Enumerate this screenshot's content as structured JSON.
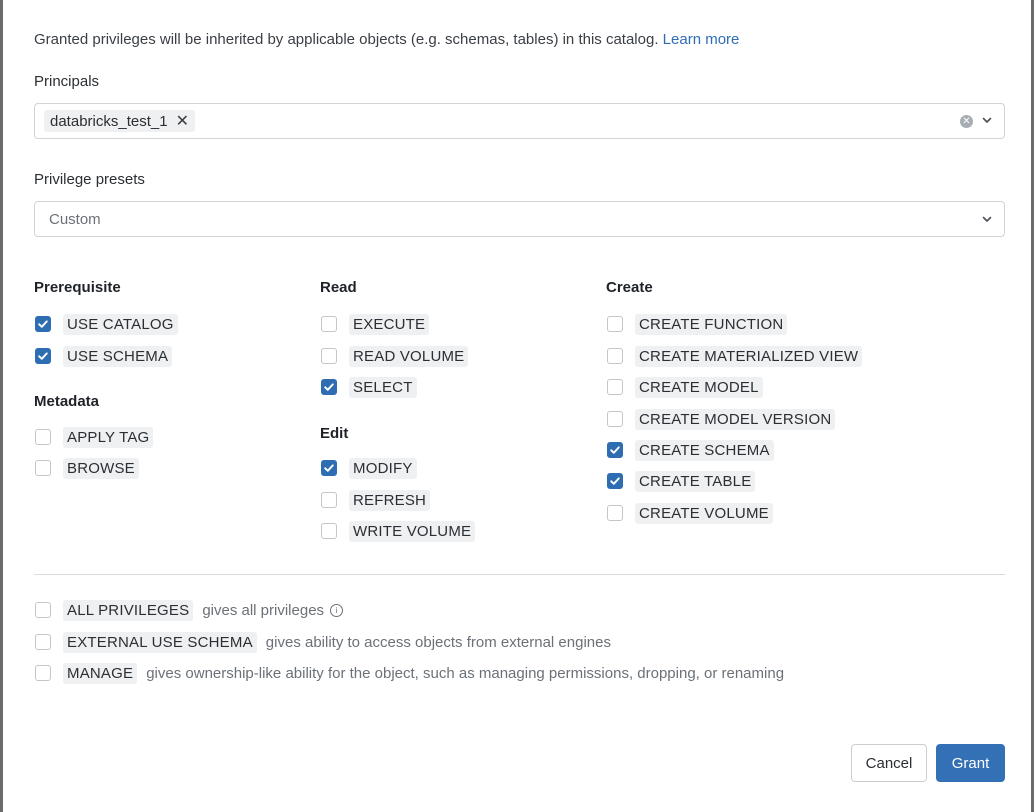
{
  "intro": {
    "text": "Granted privileges will be inherited by applicable objects (e.g. schemas, tables) in this catalog.",
    "link": "Learn more"
  },
  "principals": {
    "label": "Principals",
    "chips": [
      "databricks_test_1"
    ]
  },
  "presets": {
    "label": "Privilege presets",
    "value": "Custom"
  },
  "groups": {
    "prerequisite": {
      "title": "Prerequisite",
      "items": [
        {
          "label": "USE CATALOG",
          "checked": true
        },
        {
          "label": "USE SCHEMA",
          "checked": true
        }
      ]
    },
    "metadata": {
      "title": "Metadata",
      "items": [
        {
          "label": "APPLY TAG",
          "checked": false
        },
        {
          "label": "BROWSE",
          "checked": false
        }
      ]
    },
    "read": {
      "title": "Read",
      "items": [
        {
          "label": "EXECUTE",
          "checked": false
        },
        {
          "label": "READ VOLUME",
          "checked": false
        },
        {
          "label": "SELECT",
          "checked": true
        }
      ]
    },
    "edit": {
      "title": "Edit",
      "items": [
        {
          "label": "MODIFY",
          "checked": true
        },
        {
          "label": "REFRESH",
          "checked": false
        },
        {
          "label": "WRITE VOLUME",
          "checked": false
        }
      ]
    },
    "create": {
      "title": "Create",
      "items": [
        {
          "label": "CREATE FUNCTION",
          "checked": false
        },
        {
          "label": "CREATE MATERIALIZED VIEW",
          "checked": false
        },
        {
          "label": "CREATE MODEL",
          "checked": false
        },
        {
          "label": "CREATE MODEL VERSION",
          "checked": false
        },
        {
          "label": "CREATE SCHEMA",
          "checked": true
        },
        {
          "label": "CREATE TABLE",
          "checked": true
        },
        {
          "label": "CREATE VOLUME",
          "checked": false
        }
      ]
    }
  },
  "special": [
    {
      "label": "ALL PRIVILEGES",
      "desc": "gives all privileges",
      "checked": false,
      "info": true
    },
    {
      "label": "EXTERNAL USE SCHEMA",
      "desc": "gives ability to access objects from external engines",
      "checked": false,
      "info": false
    },
    {
      "label": "MANAGE",
      "desc": "gives ownership-like ability for the object, such as managing permissions, dropping, or renaming",
      "checked": false,
      "info": false
    }
  ],
  "buttons": {
    "cancel": "Cancel",
    "grant": "Grant"
  },
  "colors": {
    "accent": "#2f6db3",
    "primary_button": "#3470b6"
  }
}
